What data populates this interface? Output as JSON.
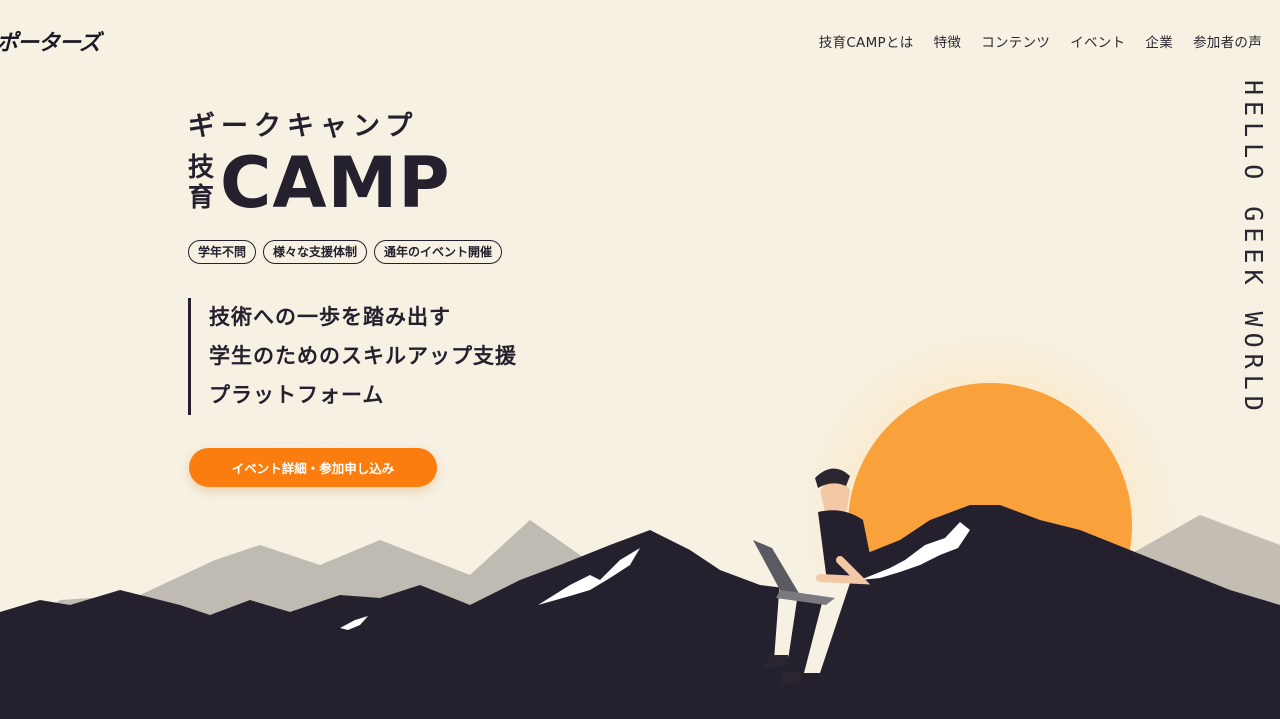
{
  "header": {
    "logo": "ポーターズ",
    "nav": [
      "技育CAMPとは",
      "特徴",
      "コンテンツ",
      "イベント",
      "企業",
      "参加者の声"
    ]
  },
  "side_text": "HELLO GEEK WORLD",
  "hero": {
    "ruby": "ギークキャンプ",
    "brand_kanji_1": "技",
    "brand_kanji_2": "育",
    "brand_camp": "CAMP",
    "tags": [
      "学年不問",
      "様々な支援体制",
      "通年のイベント開催"
    ],
    "catch": [
      "技術への一歩を踏み出す",
      "学生のためのスキルアップ支援",
      "プラットフォーム"
    ],
    "cta_label": "イベント詳細・参加申し込み"
  },
  "colors": {
    "background": "#f6f1e3",
    "ink": "#25202d",
    "accent": "#fb7d10",
    "sun": "#f9a23c"
  },
  "illustration": {
    "icons": [
      "sun",
      "mountains",
      "person-with-laptop"
    ]
  }
}
